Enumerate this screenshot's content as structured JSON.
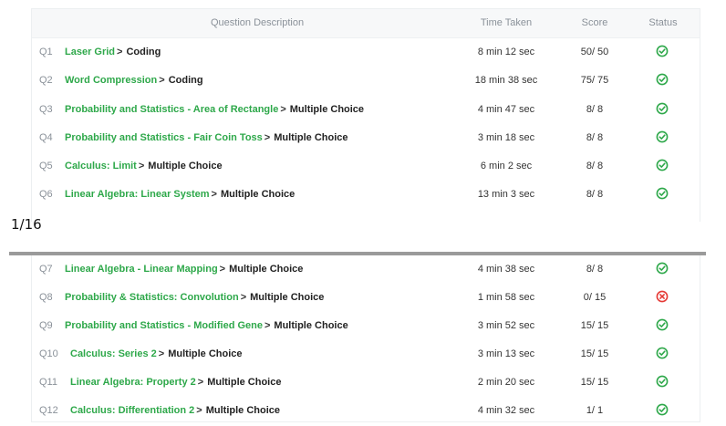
{
  "header": {
    "description": "Question Description",
    "time": "Time Taken",
    "score": "Score",
    "status": "Status"
  },
  "page_indicator": "1/16",
  "colors": {
    "topic": "#2ea84a",
    "pass": "#2ea84a",
    "fail": "#e53935"
  },
  "rows": [
    {
      "q": "Q1",
      "topic": "Laser Grid",
      "sep": ">",
      "type": "Coding",
      "time": "8 min 12 sec",
      "score": "50/ 50",
      "status": "check-icon"
    },
    {
      "q": "Q2",
      "topic": "Word Compression",
      "sep": ">",
      "type": "Coding",
      "time": "18 min 38 sec",
      "score": "75/ 75",
      "status": "check-icon"
    },
    {
      "q": "Q3",
      "topic": "Probability and Statistics - Area of Rectangle",
      "sep": ">",
      "type": "Multiple Choice",
      "time": "4 min 47 sec",
      "score": "8/ 8",
      "status": "check-icon"
    },
    {
      "q": "Q4",
      "topic": "Probability and Statistics - Fair Coin Toss",
      "sep": ">",
      "type": "Multiple Choice",
      "time": "3 min 18 sec",
      "score": "8/ 8",
      "status": "check-icon"
    },
    {
      "q": "Q5",
      "topic": "Calculus: Limit",
      "sep": ">",
      "type": "Multiple Choice",
      "time": "6 min 2 sec",
      "score": "8/ 8",
      "status": "check-icon"
    },
    {
      "q": "Q6",
      "topic": "Linear Algebra: Linear System",
      "sep": ">",
      "type": "Multiple Choice",
      "time": "13 min 3 sec",
      "score": "8/ 8",
      "status": "check-icon"
    },
    {
      "q": "Q7",
      "topic": "Linear Algebra - Linear Mapping",
      "sep": ">",
      "type": "Multiple Choice",
      "time": "4 min 38 sec",
      "score": "8/ 8",
      "status": "check-icon"
    },
    {
      "q": "Q8",
      "topic": "Probability & Statistics: Convolution",
      "sep": ">",
      "type": "Multiple Choice",
      "time": "1 min 58 sec",
      "score": "0/ 15",
      "status": "cross-icon"
    },
    {
      "q": "Q9",
      "topic": "Probability and Statistics - Modified Gene",
      "sep": ">",
      "type": "Multiple Choice",
      "time": "3 min 52 sec",
      "score": "15/ 15",
      "status": "check-icon"
    },
    {
      "q": "Q10",
      "topic": "Calculus: Series 2",
      "sep": ">",
      "type": "Multiple Choice",
      "time": "3 min 13 sec",
      "score": "15/ 15",
      "status": "check-icon"
    },
    {
      "q": "Q11",
      "topic": "Linear Algebra: Property 2",
      "sep": ">",
      "type": "Multiple Choice",
      "time": "2 min 20 sec",
      "score": "15/ 15",
      "status": "check-icon"
    },
    {
      "q": "Q12",
      "topic": "Calculus: Differentiation 2",
      "sep": ">",
      "type": "Multiple Choice",
      "time": "4 min 32 sec",
      "score": "1/ 1",
      "status": "check-icon"
    }
  ]
}
